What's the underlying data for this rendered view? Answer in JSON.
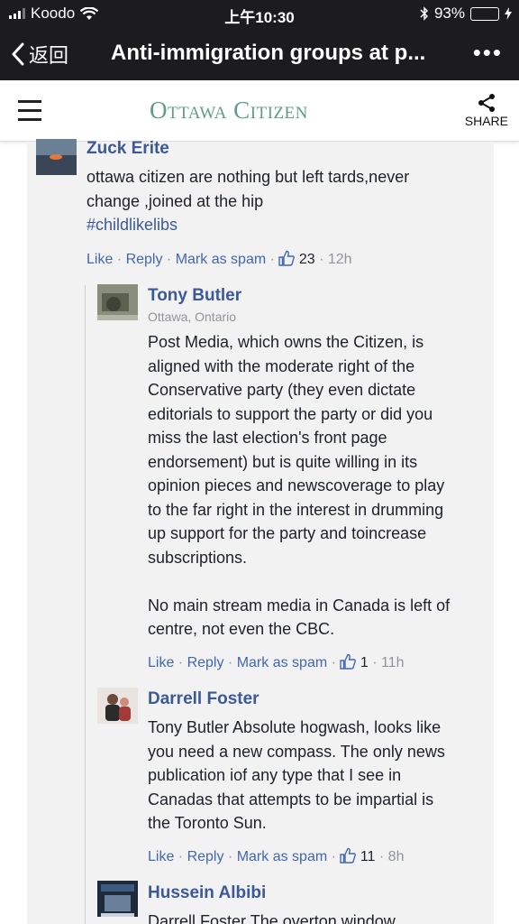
{
  "status": {
    "carrier": "Koodo",
    "time": "上午10:30",
    "battery": "93%",
    "battery_level": 0.93
  },
  "nav": {
    "back": "返回",
    "title": "Anti-immigration groups at p..."
  },
  "site": {
    "logo": "Ottawa Citizen",
    "share": "SHARE"
  },
  "comments": [
    {
      "name": "Zuck Erite",
      "body": "ottawa citizen are nothing but left tards,never\nchange ,joined at the hip",
      "hashtag": "#childlikelibs",
      "like": "Like",
      "reply": "Reply",
      "spam": "Mark as spam",
      "likes": "23",
      "time": "12h"
    },
    {
      "name": "Tony Butler",
      "location": "Ottawa, Ontario",
      "body": "Post Media, which owns the Citizen, is\naligned with the moderate right of the\nConservative party (they even dictate\neditorials to support the party or did you\nmiss the last election's front page\nendorsement) but is quite willing in its\nopinion pieces and newscoverage to play\nto the far right in the interest in drumming\nup support for the party and toincrease\nsubscriptions.\n\nNo main stream media in Canada is left of\ncentre, not even the CBC.",
      "like": "Like",
      "reply": "Reply",
      "spam": "Mark as spam",
      "likes": "1",
      "time": "11h"
    },
    {
      "name": "Darrell Foster",
      "body": "Tony Butler Absolute hogwash, looks like\nyou need a new compass. The only news\npublication iof any type that I see in\nCanadas that attempts to be impartial is\nthe Toronto Sun.",
      "like": "Like",
      "reply": "Reply",
      "spam": "Mark as spam",
      "likes": "11",
      "time": "8h"
    },
    {
      "name": "Hussein Albibi",
      "body": "Darrell Foster The overton window"
    }
  ],
  "colors": {
    "link": "#3b5998",
    "logo": "#5e9e8a",
    "bar": "#1c1c1e"
  }
}
